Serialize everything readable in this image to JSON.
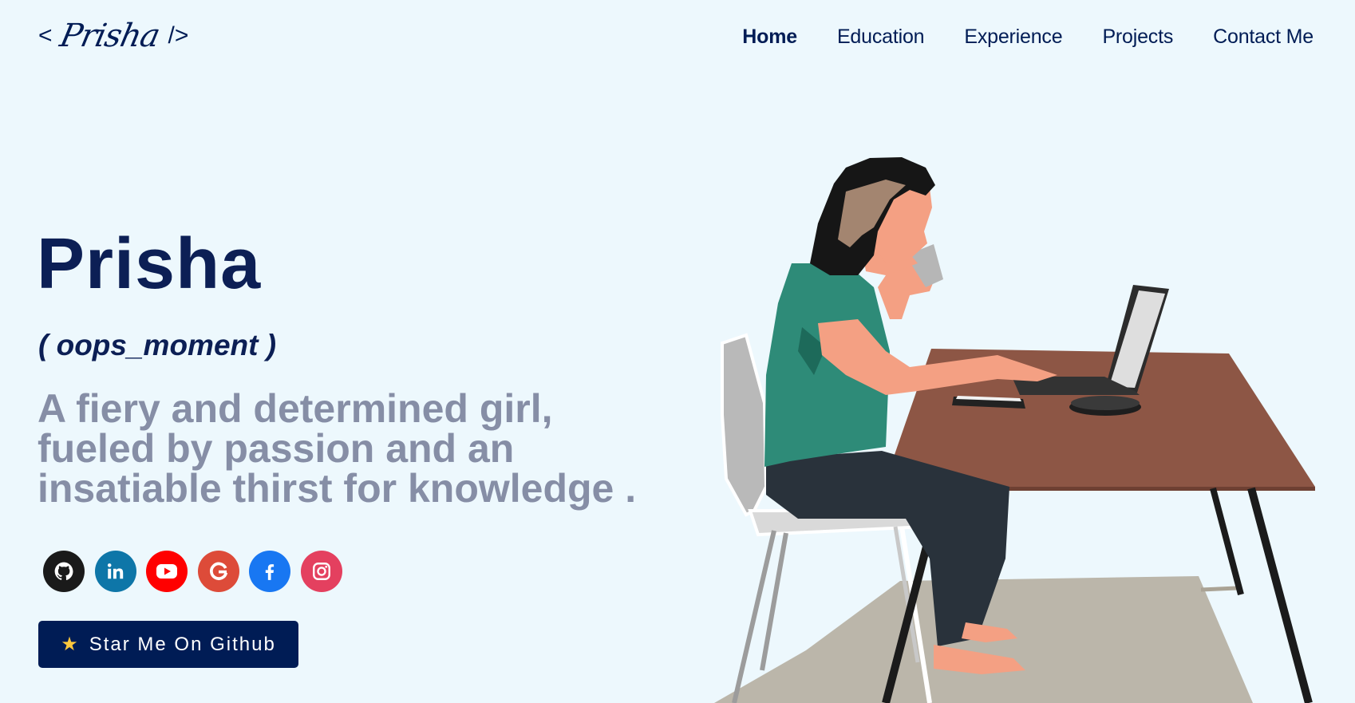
{
  "header": {
    "logo_open": "<",
    "logo_signature": "Prisha",
    "logo_close": "/>",
    "nav": [
      {
        "label": "Home",
        "active": true
      },
      {
        "label": "Education",
        "active": false
      },
      {
        "label": "Experience",
        "active": false
      },
      {
        "label": "Projects",
        "active": false
      },
      {
        "label": "Contact Me",
        "active": false
      }
    ]
  },
  "hero": {
    "name": "Prisha",
    "handle": "( oops_moment )",
    "tagline": "A fiery and determined girl, fueled by passion and an insatiable thirst for knowledge .",
    "socials": [
      {
        "icon": "github-icon",
        "color": "#1a1a1a"
      },
      {
        "icon": "linkedin-icon",
        "color": "#0e76a8"
      },
      {
        "icon": "youtube-icon",
        "color": "#ff0000"
      },
      {
        "icon": "google-icon",
        "color": "#dd4b39"
      },
      {
        "icon": "facebook-icon",
        "color": "#1877f2"
      },
      {
        "icon": "instagram-icon",
        "color": "#e4405f"
      }
    ],
    "cta_label": "Star Me On Github",
    "cta_icon": "star-icon"
  },
  "theme": {
    "background": "#edf8fd",
    "primary": "#001c55",
    "muted_text": "#868ea6"
  }
}
